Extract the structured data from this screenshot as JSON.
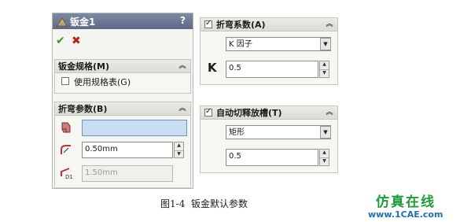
{
  "left_panel": {
    "title": "钣金1",
    "help_glyph": "?",
    "ok_glyph": "✔",
    "cancel_glyph": "✖",
    "gauge_group": {
      "title": "钣金规格(M)",
      "use_gauge_table_label": "使用规格表(G)",
      "use_gauge_table_checked": false
    },
    "bend_params_group": {
      "title": "折弯参数(B)",
      "face_value": "",
      "radius_value": "0.50mm",
      "thickness_value": "1.50mm"
    }
  },
  "right_panel": {
    "bend_allowance_group": {
      "title": "折弯系数(A)",
      "checked": true,
      "type_value": "K 因子",
      "k_label": "K",
      "k_value": "0.5"
    },
    "auto_relief_group": {
      "title": "自动切释放槽(T)",
      "checked": true,
      "type_value": "矩形",
      "ratio_value": "0.5"
    }
  },
  "caption": "图1-4  钣金默认参数",
  "brand_cn": "仿真在线",
  "brand_url": "www.1CAE.com",
  "colors": {
    "brand_green": "#1a9c3a",
    "brand_blue": "#1d6fb8",
    "accept_green": "#2e9a2e",
    "cancel_red": "#c02020",
    "focus_blue": "#c8dcf2"
  }
}
